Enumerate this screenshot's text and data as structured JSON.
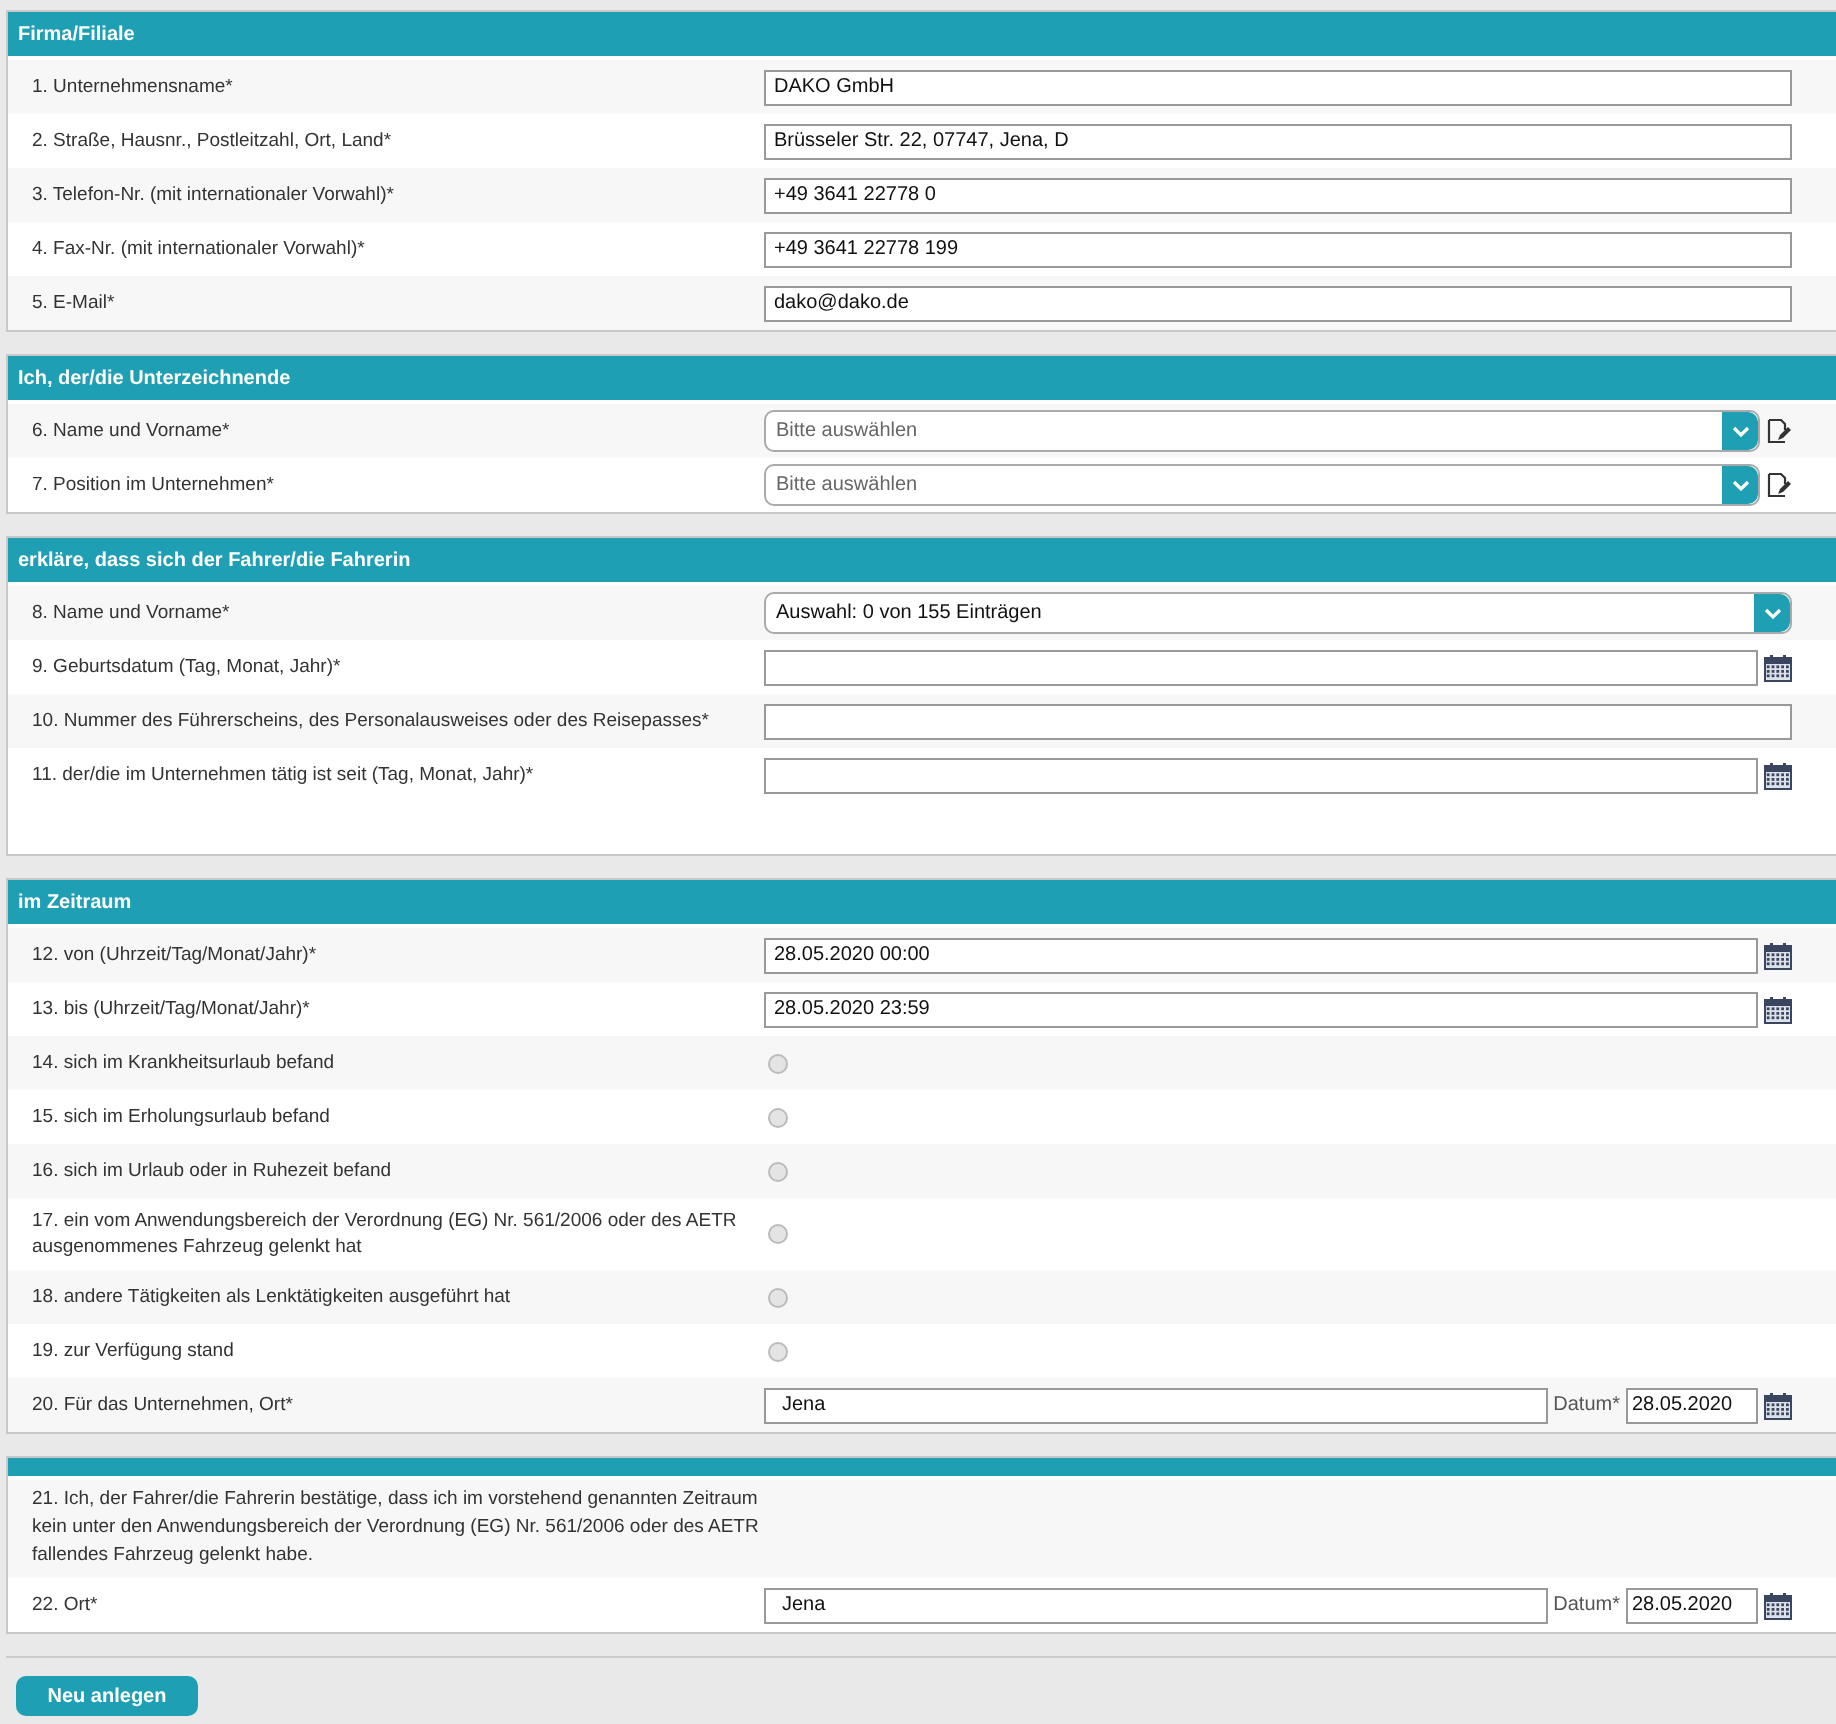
{
  "sections": [
    {
      "title": "Firma/Filiale",
      "rows": [
        {
          "kind": "text",
          "label": "1. Unternehmensname*",
          "value": "DAKO GmbH"
        },
        {
          "kind": "text",
          "label": "2. Straße, Hausnr., Postleitzahl, Ort, Land*",
          "value": "Brüsseler Str. 22, 07747, Jena, D"
        },
        {
          "kind": "text",
          "label": "3. Telefon-Nr. (mit internationaler Vorwahl)*",
          "value": "+49 3641 22778 0"
        },
        {
          "kind": "text",
          "label": "4. Fax-Nr. (mit internationaler Vorwahl)*",
          "value": "+49 3641 22778 199"
        },
        {
          "kind": "text",
          "label": "5. E-Mail*",
          "value": "dako@dako.de"
        }
      ]
    },
    {
      "title": "Ich, der/die Unterzeichnende",
      "rows": [
        {
          "kind": "select",
          "label": "6. Name und Vorname*",
          "placeholder": "Bitte auswählen"
        },
        {
          "kind": "select",
          "label": "7. Position im Unternehmen*",
          "placeholder": "Bitte auswählen"
        }
      ]
    },
    {
      "title": "erkläre, dass sich der Fahrer/die Fahrerin",
      "spacer": true,
      "rows": [
        {
          "kind": "multiselect",
          "label": "8. Name und Vorname*",
          "value": "Auswahl: 0 von 155 Einträgen"
        },
        {
          "kind": "date",
          "label": "9. Geburtsdatum (Tag, Monat, Jahr)*"
        },
        {
          "kind": "text",
          "label": "10. Nummer des Führerscheins, des Personalausweises oder des Reisepasses*"
        },
        {
          "kind": "date",
          "label": "11. der/die im Unternehmen tätig ist seit (Tag, Monat, Jahr)*"
        }
      ]
    },
    {
      "title": "im Zeitraum",
      "rows": [
        {
          "kind": "date",
          "label": "12. von (Uhrzeit/Tag/Monat/Jahr)*",
          "value": "28.05.2020 00:00"
        },
        {
          "kind": "date",
          "label": "13. bis (Uhrzeit/Tag/Monat/Jahr)*",
          "value": "28.05.2020 23:59"
        },
        {
          "kind": "radio",
          "label": "14. sich im Krankheitsurlaub befand",
          "checked": false
        },
        {
          "kind": "radio",
          "label": "15. sich im Erholungsurlaub befand",
          "checked": false
        },
        {
          "kind": "radio",
          "label": "16. sich im Urlaub oder in Ruhezeit befand",
          "checked": false
        },
        {
          "kind": "radio",
          "label": "17. ein vom Anwendungsbereich der Verordnung (EG) Nr. 561/2006 oder des AETR ausgenommenes Fahrzeug gelenkt hat",
          "checked": false
        },
        {
          "kind": "radio",
          "label": "18. andere Tätigkeiten als Lenktätigkeiten ausgeführt hat",
          "checked": false
        },
        {
          "kind": "radio",
          "label": "19. zur Verfügung stand",
          "checked": false
        },
        {
          "kind": "place_date",
          "label": "20. Für das Unternehmen, Ort*",
          "value": "Jena",
          "date_label": "Datum*",
          "date": "28.05.2020"
        }
      ]
    },
    {
      "rows": [
        {
          "kind": "statement",
          "label": "21. Ich, der Fahrer/die Fahrerin bestätige, dass ich im vorstehend genannten Zeitraum kein unter den Anwendungsbereich der Verordnung (EG) Nr. 561/2006 oder des AETR fallendes Fahrzeug gelenkt habe."
        },
        {
          "kind": "place_date",
          "label": "22. Ort*",
          "value": "Jena",
          "date_label": "Datum*",
          "date": "28.05.2020"
        }
      ]
    }
  ],
  "button": "Neu anlegen"
}
